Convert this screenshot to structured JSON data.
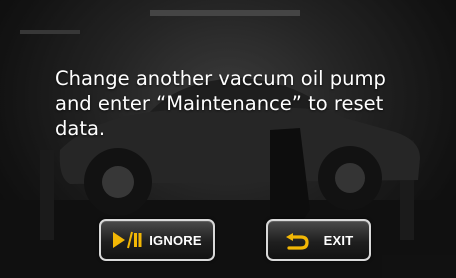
{
  "dialog": {
    "message": "Change another vaccum oil pump\nand enter “Maintenance” to reset\ndata."
  },
  "buttons": {
    "ignore": {
      "label": "IGNORE",
      "icon": "play-pause-icon"
    },
    "exit": {
      "label": "EXIT",
      "icon": "return-arrow-icon"
    }
  },
  "colors": {
    "icon_accent": "#f2b705",
    "text": "#ffffff",
    "button_border": "#d9d9d9"
  }
}
